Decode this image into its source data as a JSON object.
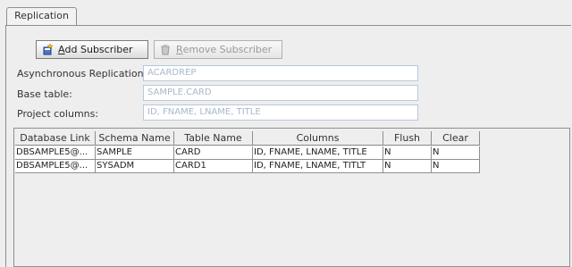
{
  "tabs": [
    {
      "label": "Replication",
      "selected": true
    }
  ],
  "toolbar": {
    "add_label_mnemonic": "A",
    "add_label_rest": "dd Subscriber",
    "add_icon": "add-subscriber-icon",
    "remove_label_mnemonic": "R",
    "remove_label_rest": "emove Subscriber",
    "remove_icon": "remove-subscriber-icon",
    "remove_enabled": false
  },
  "form": {
    "async_label": "Asynchronous Replication:",
    "async_value": "ACARDREP",
    "base_label": "Base table:",
    "base_value": "SAMPLE.CARD",
    "project_label": "Project columns:",
    "project_value": "ID, FNAME, LNAME, TITLE"
  },
  "table": {
    "headers": [
      "Database Link",
      "Schema Name",
      "Table Name",
      "Columns",
      "Flush",
      "Clear"
    ],
    "rows": [
      [
        "DBSAMPLE5@...",
        "SAMPLE",
        "CARD",
        "ID, FNAME, LNAME, TITLE",
        "N",
        "N"
      ],
      [
        "DBSAMPLE5@...",
        "SYSADM",
        "CARD1",
        "ID, FNAME, LNAME, TITLT",
        "N",
        "N"
      ]
    ]
  },
  "colors": {
    "field_text": "#a8b8cc",
    "field_border": "#b8c8d8",
    "panel_bg": "#eeeeee",
    "border": "#8e8f8f"
  }
}
